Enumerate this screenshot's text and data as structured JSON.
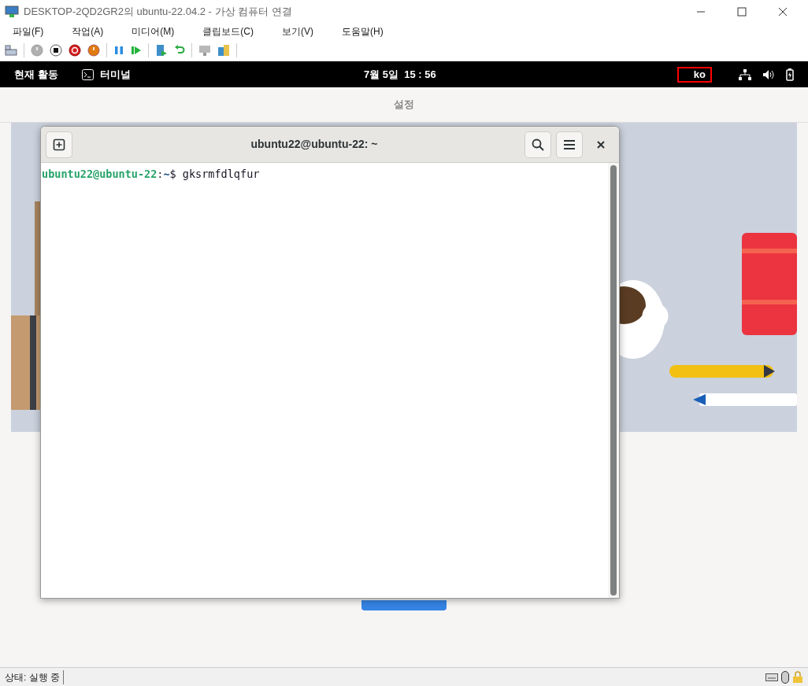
{
  "host_window": {
    "title": "DESKTOP-2QD2GR2의 ubuntu-22.04.2 - 가상 컴퓨터 연결"
  },
  "menu": [
    "파일(F)",
    "작업(A)",
    "미디어(M)",
    "클립보드(C)",
    "보기(V)",
    "도움말(H)"
  ],
  "gnome_bar": {
    "activities": "현재 활동",
    "app": "터미널",
    "clock": "7월 5일  15 : 56",
    "input_method": "ko"
  },
  "settings": {
    "title": "설정"
  },
  "terminal": {
    "title": "ubuntu22@ubuntu-22: ~",
    "prompt_user": "ubuntu22@ubuntu-22",
    "prompt_colon": ":",
    "prompt_path": "~",
    "prompt_sign": "$",
    "command": "gksrmfdlqfur"
  },
  "status_bar": {
    "status": "상태: 실행 중"
  }
}
